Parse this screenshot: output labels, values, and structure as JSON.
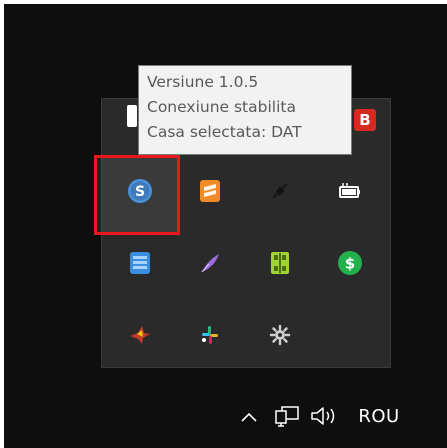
{
  "tooltip": {
    "lines": [
      "Versiune 1.0.5",
      "Conexiune stabilita",
      "Casa selectata: DAT"
    ]
  },
  "tray_icons": [
    {
      "name": "app-s-coin-icon",
      "color": "#3b8ad9",
      "glyph": "S",
      "selected": true
    },
    {
      "name": "app-sublime-icon",
      "color": "#f08c28"
    },
    {
      "name": "plug-icon",
      "color": "#1c1c1c"
    },
    {
      "name": "battery-plug-icon",
      "color": "#ffffff"
    },
    {
      "name": "app-blue-square-icon",
      "color": "#3a8ee0"
    },
    {
      "name": "feather-pen-icon",
      "color": "#9b6bdf"
    },
    {
      "name": "app-green-grid-icon",
      "color": "#a0d432"
    },
    {
      "name": "green-dollar-icon",
      "color": "#22b14c",
      "glyph": "$"
    },
    {
      "name": "app-red-star-icon",
      "color": "#c0392b"
    },
    {
      "name": "slack-icon",
      "color": "#ecb22e"
    },
    {
      "name": "gear-bug-icon",
      "color": "#cfcfcf"
    },
    {
      "name": "app-b-icon",
      "color": "#d42a20",
      "glyph": "B"
    }
  ],
  "taskbar": {
    "language": "ROU"
  }
}
